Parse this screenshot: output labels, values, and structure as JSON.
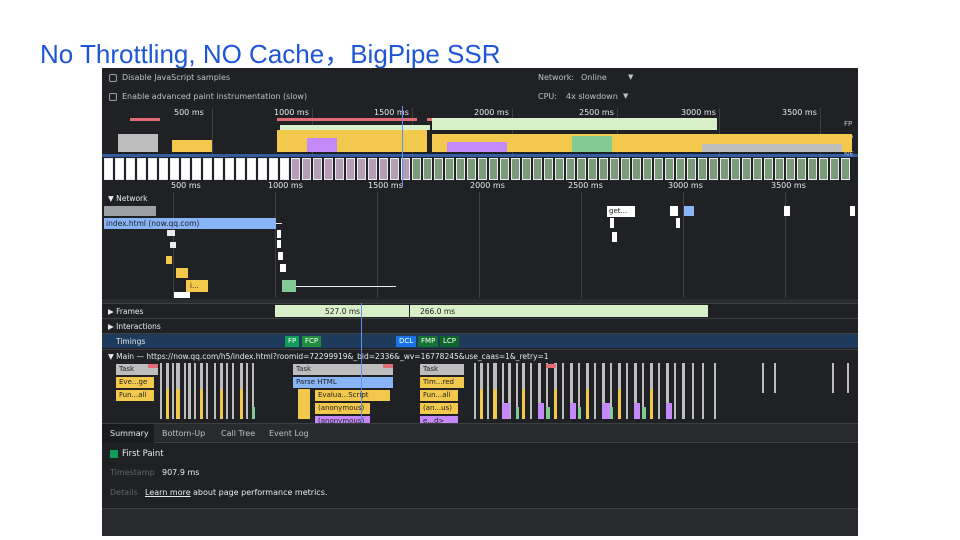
{
  "slide": {
    "title": "No Throttling, NO Cache，BigPipe SSR"
  },
  "settings": {
    "disable_js_samples": "Disable JavaScript samples",
    "enable_paint_instrumentation": "Enable advanced paint instrumentation (slow)",
    "network_label": "Network:",
    "network_value": "Online",
    "cpu_label": "CPU:",
    "cpu_value": "4x slowdown"
  },
  "overview": {
    "ticks": [
      "500 ms",
      "1000 ms",
      "1500 ms",
      "2000 ms",
      "2500 ms",
      "3000 ms",
      "3500 ms"
    ],
    "right_labels": [
      "FP",
      "CP",
      "NE"
    ]
  },
  "ruler": {
    "ticks": [
      "500 ms",
      "1000 ms",
      "1500 ms",
      "2000 ms",
      "2500 ms",
      "3000 ms",
      "3500 ms"
    ]
  },
  "network": {
    "label": "Network",
    "main_request": "index.html (now.qq.com)",
    "get_request": "get...",
    "small_request": "i..."
  },
  "tracks": {
    "frames_label": "Frames",
    "frame_durations": [
      "527.0 ms",
      "266.0 ms"
    ],
    "interactions_label": "Interactions",
    "timings_label": "Timings",
    "timing_markers": [
      "FP",
      "FCP",
      "DCL",
      "FMP",
      "LCP"
    ],
    "main_label": "Main — https://now.qq.com/h5/index.html?roomid=72299919&_bid=2336&_wv=16778245&use_caas=1&_retry=1"
  },
  "main_events": {
    "task1": "Task",
    "eve_ge": "Eve...ge",
    "fun_all1": "Fun...all",
    "task2": "Task",
    "parse_html": "Parse HTML",
    "evalua_script": "Evalua...Script",
    "anonymous1": "(anonymous)",
    "anonymous2": "(anonymous)",
    "task3": "Task",
    "tim_red": "Tim...red",
    "fun_all2": "Fun...all",
    "an_us": "(an...us)",
    "e_d": "e...d>"
  },
  "bottom_tabs": [
    "Summary",
    "Bottom-Up",
    "Call Tree",
    "Event Log"
  ],
  "summary": {
    "event_name": "First Paint",
    "timestamp_label": "Timestamp",
    "timestamp_value": "907.9 ms",
    "details_label": "Details",
    "learn_more": "Learn more",
    "details_suffix": "about page performance metrics."
  },
  "colors": {
    "slide_title": "#1e56d6",
    "panel_bg": "#202124",
    "scripting": "#f2c94c",
    "loading": "#8ab4f8",
    "painting": "#81c995",
    "rendering": "#c58af9",
    "task": "#bdbdbd",
    "long_task": "#e06c75",
    "frame": "#d7f0c8"
  }
}
